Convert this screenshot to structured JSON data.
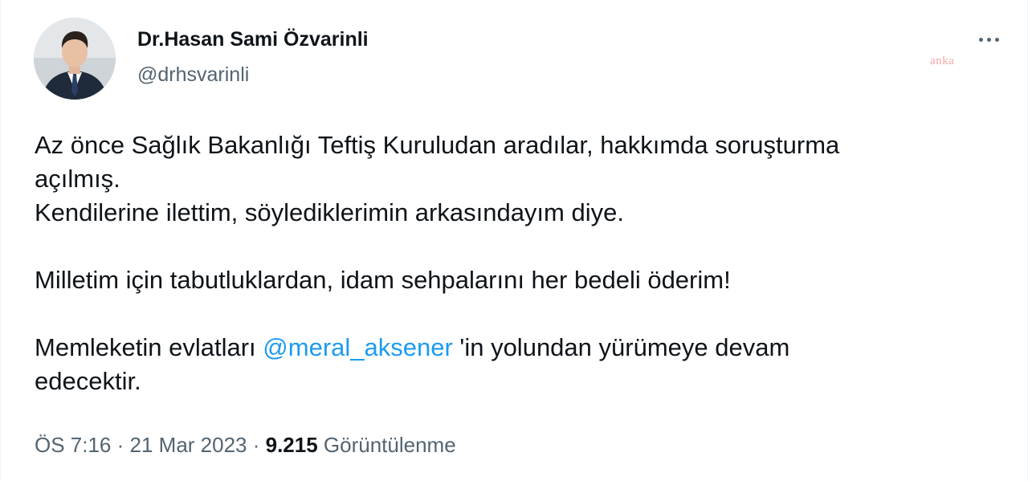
{
  "author": {
    "name": "Dr.Hasan Sami Özvarinli",
    "handle": "@drhsvarinli"
  },
  "watermark": "anka",
  "more_icon": "ellipsis-icon",
  "tweet": {
    "line1": "Az önce Sağlık Bakanlığı Teftiş Kuruludan aradılar, hakkımda soruşturma",
    "line2": "açılmış.",
    "line3": "Kendilerine ilettim, söylediklerimin arkasındayım diye.",
    "line4": "Milletim için tabutluklardan, idam sehpalarını her bedeli öderim!",
    "line5_before": "Memleketin evlatları ",
    "mention": "@meral_aksener",
    "line5_after": " 'in yolundan yürümeye devam",
    "line6": "edecektir."
  },
  "meta": {
    "time": "ÖS 7:16",
    "separator1": " · ",
    "date": "21 Mar 2023",
    "separator2": " · ",
    "views_count": "9.215",
    "views_label": " Görüntülenme"
  },
  "colors": {
    "text": "#0f1419",
    "secondary": "#536471",
    "link": "#1d9bf0",
    "watermark": "#f4a6a6"
  }
}
